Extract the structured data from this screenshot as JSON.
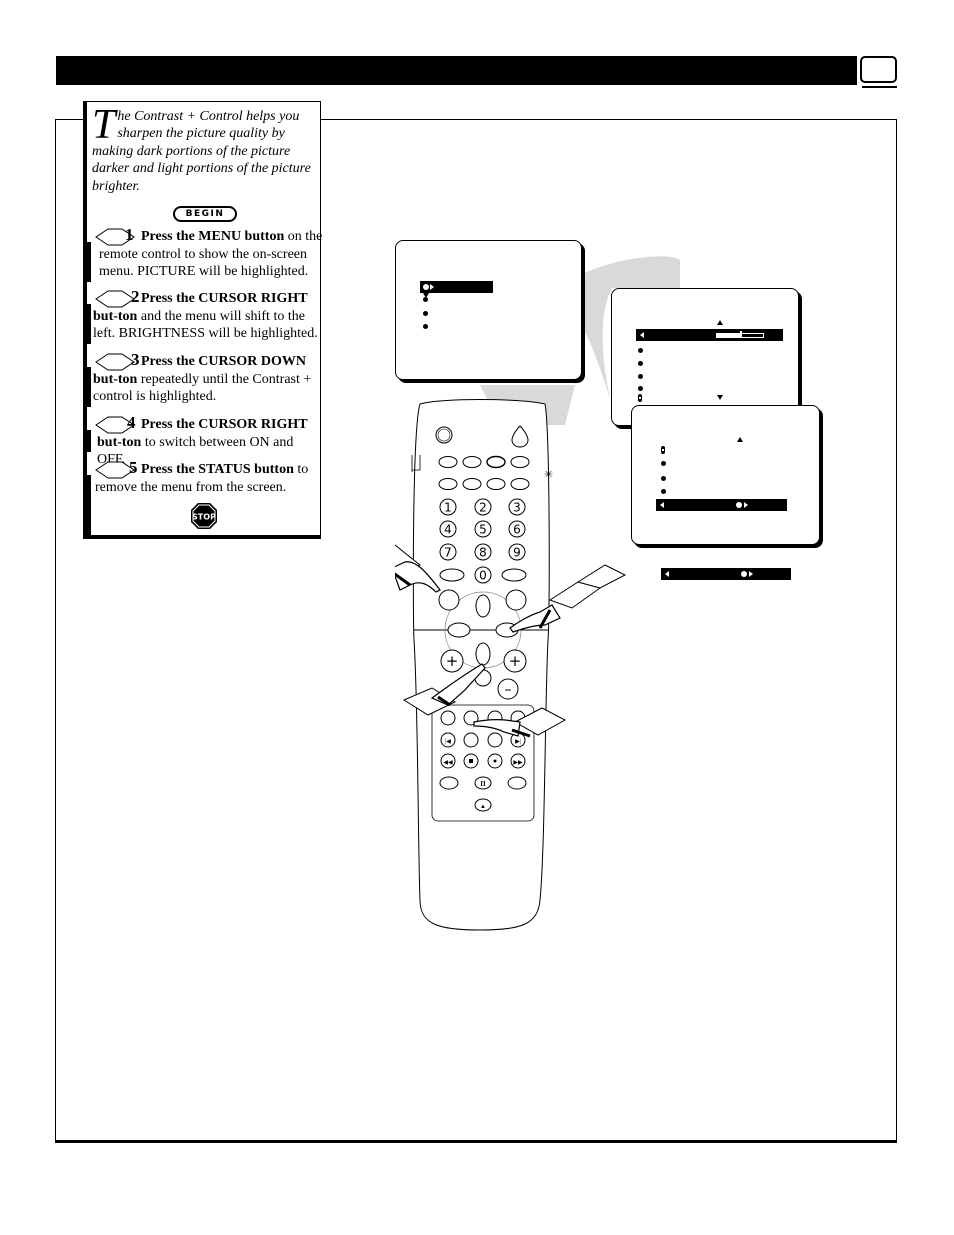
{
  "page": {
    "header_bar_color": "#000000",
    "page_number": ""
  },
  "intro": {
    "drop_cap": "T",
    "text": "he Contrast + Control helps you sharpen the picture quality by making dark portions of the picture darker and light portions of the picture brighter."
  },
  "begin_label": "BEGIN",
  "steps": [
    {
      "number": "1",
      "bold": "Press the MENU button",
      "rest": " on the remote control to show the on-screen menu. PICTURE will be highlighted."
    },
    {
      "number": "2",
      "bold": "Press the CURSOR RIGHT but-ton",
      "rest": " and the menu will shift to the left. BRIGHTNESS will be highlighted."
    },
    {
      "number": "3",
      "bold": "Press the CURSOR DOWN but-ton",
      "rest": " repeatedly until the Contrast + control is highlighted."
    },
    {
      "number": "4",
      "bold": "Press the CURSOR RIGHT but-ton",
      "rest": " to switch between ON and OFF."
    },
    {
      "number": "5",
      "bold": "Press the STATUS button",
      "rest": " to remove the menu from the screen."
    }
  ],
  "stop_label": "STOP",
  "screens": {
    "menu_main": {
      "highlighted_index": 0,
      "item_count": 4
    },
    "menu_picture": {
      "highlighted_index": 0,
      "item_count": 6,
      "slider_level_percent": 50
    },
    "menu_contrast": {
      "highlighted_index": 4,
      "item_count": 5,
      "toggle_state": "on"
    }
  },
  "remote": {
    "number_keys": [
      "1",
      "2",
      "3",
      "4",
      "5",
      "6",
      "7",
      "8",
      "9",
      "0"
    ]
  }
}
